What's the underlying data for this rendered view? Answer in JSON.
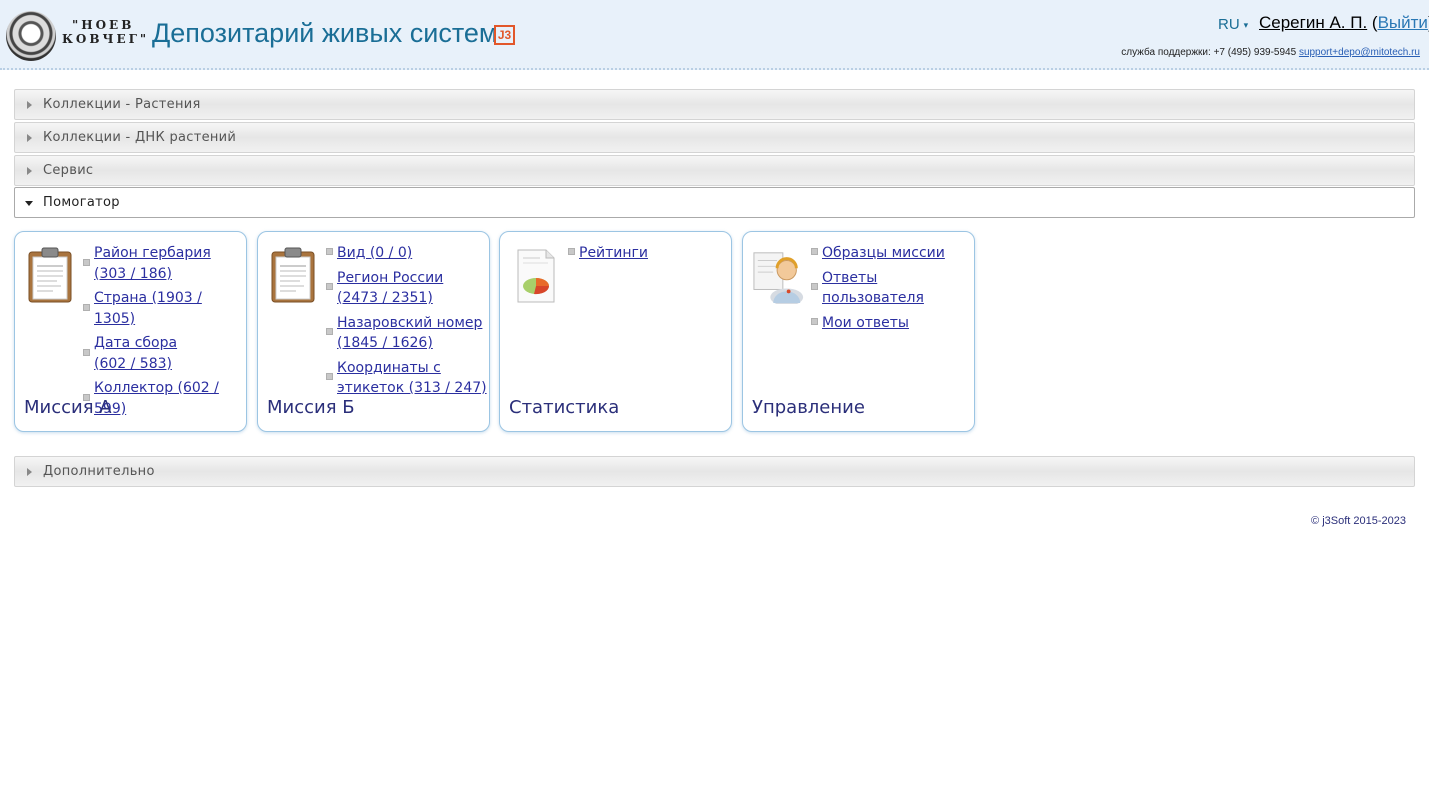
{
  "header": {
    "logo_line1": "\"НОЕВ",
    "logo_line2": "КОВЧЕГ\"",
    "title": "Депозитарий живых систем",
    "badge": "J3",
    "lang": "RU",
    "user_name": "Серегин А. П.",
    "logout_label": "Выйти",
    "support_label": "служба поддержки: +7 (495) 939-5945",
    "support_email": "support+depo@mitotech.ru"
  },
  "accordion": [
    {
      "label": "Коллекции - Растения",
      "open": false
    },
    {
      "label": "Коллекции - ДНК растений",
      "open": false
    },
    {
      "label": "Сервис",
      "open": false
    },
    {
      "label": "Помогатор",
      "open": true
    }
  ],
  "tiles": [
    {
      "title": "Миссия А",
      "icon": "clipboard-icon",
      "links": [
        [
          "Район гербария",
          "(303 / 186)"
        ],
        [
          "Страна (1903 / 1305)"
        ],
        [
          "Дата сбора",
          "(602 / 583)"
        ],
        [
          "Коллектор (602 / 599)"
        ]
      ]
    },
    {
      "title": "Миссия Б",
      "icon": "clipboard-icon",
      "links": [
        [
          "Вид (0 / 0)"
        ],
        [
          "Регион России",
          "(2473 / 2351)"
        ],
        [
          "Назаровский номер",
          "(1845 / 1626)"
        ],
        [
          "Координаты с",
          "этикеток (313 / 247)"
        ]
      ]
    },
    {
      "title": "Статистика",
      "icon": "report-chart-icon",
      "links": [
        [
          "Рейтинги"
        ]
      ]
    },
    {
      "title": "Управление",
      "icon": "support-agent-icon",
      "links": [
        [
          "Образцы миссии"
        ],
        [
          "Ответы пользователя"
        ],
        [
          "Мои ответы"
        ]
      ]
    }
  ],
  "extra_section": {
    "label": "Дополнительно",
    "open": false
  },
  "footer": {
    "copyright": "© j3Soft 2015-2023"
  }
}
